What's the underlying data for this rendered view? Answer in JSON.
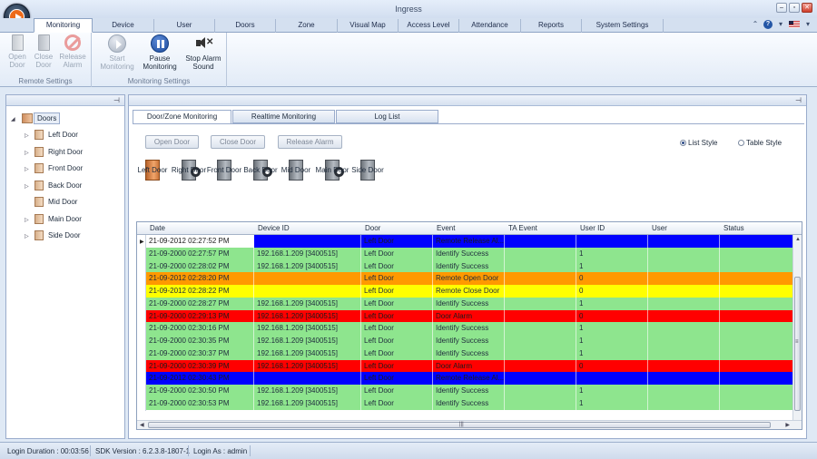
{
  "window": {
    "title": "Ingress"
  },
  "ribbon_tabs": [
    "Monitoring",
    "Device",
    "User",
    "Doors",
    "Zone",
    "Visual Map",
    "Access Level",
    "Attendance",
    "Reports",
    "System Settings"
  ],
  "ribbon": {
    "remote_settings": {
      "label": "Remote Settings",
      "open_door": [
        "Open",
        "Door"
      ],
      "close_door": [
        "Close",
        "Door"
      ],
      "release_alarm": [
        "Release",
        "Alarm"
      ]
    },
    "monitoring_settings": {
      "label": "Monitoring Settings",
      "start_monitoring": [
        "Start",
        "Monitoring"
      ],
      "pause_monitoring": [
        "Pause",
        "Monitoring"
      ],
      "stop_alarm_sound": [
        "Stop Alarm",
        "Sound"
      ]
    }
  },
  "tree": {
    "root": "Doors",
    "items": [
      "Left Door",
      "Right Door",
      "Front Door",
      "Back Door",
      "Mid Door",
      "Main Door",
      "Side Door"
    ]
  },
  "main_tabs": [
    "Door/Zone Monitoring",
    "Realtime Monitoring",
    "Log List"
  ],
  "actions": {
    "open_door": "Open Door",
    "close_door": "Close Door",
    "release_alarm": "Release Alarm"
  },
  "view_options": {
    "list_style": "List Style",
    "table_style": "Table Style",
    "selected": "List Style"
  },
  "door_tiles": [
    {
      "label": "Left Door",
      "state": "open"
    },
    {
      "label": "Right Door",
      "state": "alarm"
    },
    {
      "label": "Front Door",
      "state": "closed"
    },
    {
      "label": "Back Door",
      "state": "alarm"
    },
    {
      "label": "Mid Door",
      "state": "closed"
    },
    {
      "label": "Main Door",
      "state": "alarm"
    },
    {
      "label": "Side Door",
      "state": "closed"
    }
  ],
  "grid": {
    "columns": [
      "Date",
      "Device ID",
      "Door",
      "Event",
      "TA Event",
      "User ID",
      "User",
      "Status"
    ],
    "rows": [
      {
        "date": "21-09-2012 02:27:52 PM",
        "device": "",
        "door": "Left Door",
        "event": "Remote Release Al...",
        "ta": "",
        "user_id": "",
        "user": "",
        "status": "",
        "color": "blue"
      },
      {
        "date": "21-09-2000 02:27:57 PM",
        "device": "192.168.1.209 [3400515]",
        "door": "Left Door",
        "event": "Identify Success",
        "ta": "",
        "user_id": "1",
        "user": "",
        "status": "",
        "color": "green"
      },
      {
        "date": "21-09-2000 02:28:02 PM",
        "device": "192.168.1.209 [3400515]",
        "door": "Left Door",
        "event": "Identify Success",
        "ta": "",
        "user_id": "1",
        "user": "",
        "status": "",
        "color": "green"
      },
      {
        "date": "21-09-2012 02:28:20 PM",
        "device": "",
        "door": "Left Door",
        "event": "Remote Open Door",
        "ta": "",
        "user_id": "0",
        "user": "",
        "status": "",
        "color": "orange"
      },
      {
        "date": "21-09-2012 02:28:22 PM",
        "device": "",
        "door": "Left Door",
        "event": "Remote Close Door",
        "ta": "",
        "user_id": "0",
        "user": "",
        "status": "",
        "color": "yellow"
      },
      {
        "date": "21-09-2000 02:28:27 PM",
        "device": "192.168.1.209 [3400515]",
        "door": "Left Door",
        "event": "Identify Success",
        "ta": "",
        "user_id": "1",
        "user": "",
        "status": "",
        "color": "green"
      },
      {
        "date": "21-09-2000 02:29:13 PM",
        "device": "192.168.1.209 [3400515]",
        "door": "Left Door",
        "event": "Door Alarm",
        "ta": "",
        "user_id": "0",
        "user": "",
        "status": "",
        "color": "red"
      },
      {
        "date": "21-09-2000 02:30:16 PM",
        "device": "192.168.1.209 [3400515]",
        "door": "Left Door",
        "event": "Identify Success",
        "ta": "",
        "user_id": "1",
        "user": "",
        "status": "",
        "color": "green"
      },
      {
        "date": "21-09-2000 02:30:35 PM",
        "device": "192.168.1.209 [3400515]",
        "door": "Left Door",
        "event": "Identify Success",
        "ta": "",
        "user_id": "1",
        "user": "",
        "status": "",
        "color": "green"
      },
      {
        "date": "21-09-2000 02:30:37 PM",
        "device": "192.168.1.209 [3400515]",
        "door": "Left Door",
        "event": "Identify Success",
        "ta": "",
        "user_id": "1",
        "user": "",
        "status": "",
        "color": "green"
      },
      {
        "date": "21-09-2000 02:30:39 PM",
        "device": "192.168.1.209 [3400515]",
        "door": "Left Door",
        "event": "Door Alarm",
        "ta": "",
        "user_id": "0",
        "user": "",
        "status": "",
        "color": "red"
      },
      {
        "date": "21-09-2012 02:30:43 PM",
        "device": "",
        "door": "Left Door",
        "event": "Remote Release Al...",
        "ta": "",
        "user_id": "",
        "user": "",
        "status": "",
        "color": "blue"
      },
      {
        "date": "21-09-2000 02:30:50 PM",
        "device": "192.168.1.209 [3400515]",
        "door": "Left Door",
        "event": "Identify Success",
        "ta": "",
        "user_id": "1",
        "user": "",
        "status": "",
        "color": "green"
      },
      {
        "date": "21-09-2000 02:30:53 PM",
        "device": "192.168.1.209 [3400515]",
        "door": "Left Door",
        "event": "Identify Success",
        "ta": "",
        "user_id": "1",
        "user": "",
        "status": "",
        "color": "green"
      }
    ]
  },
  "row_colors": {
    "green": "#8ee58e",
    "orange": "#ff9900",
    "yellow": "#ffff00",
    "red": "#ff0000",
    "blue": "#0000ff"
  },
  "status_bar": {
    "login_duration": "Login Duration : 00:03:56",
    "sdk_version": "SDK Version : 6.2.3.8-1807-1",
    "login_as": "Login As : admin"
  }
}
